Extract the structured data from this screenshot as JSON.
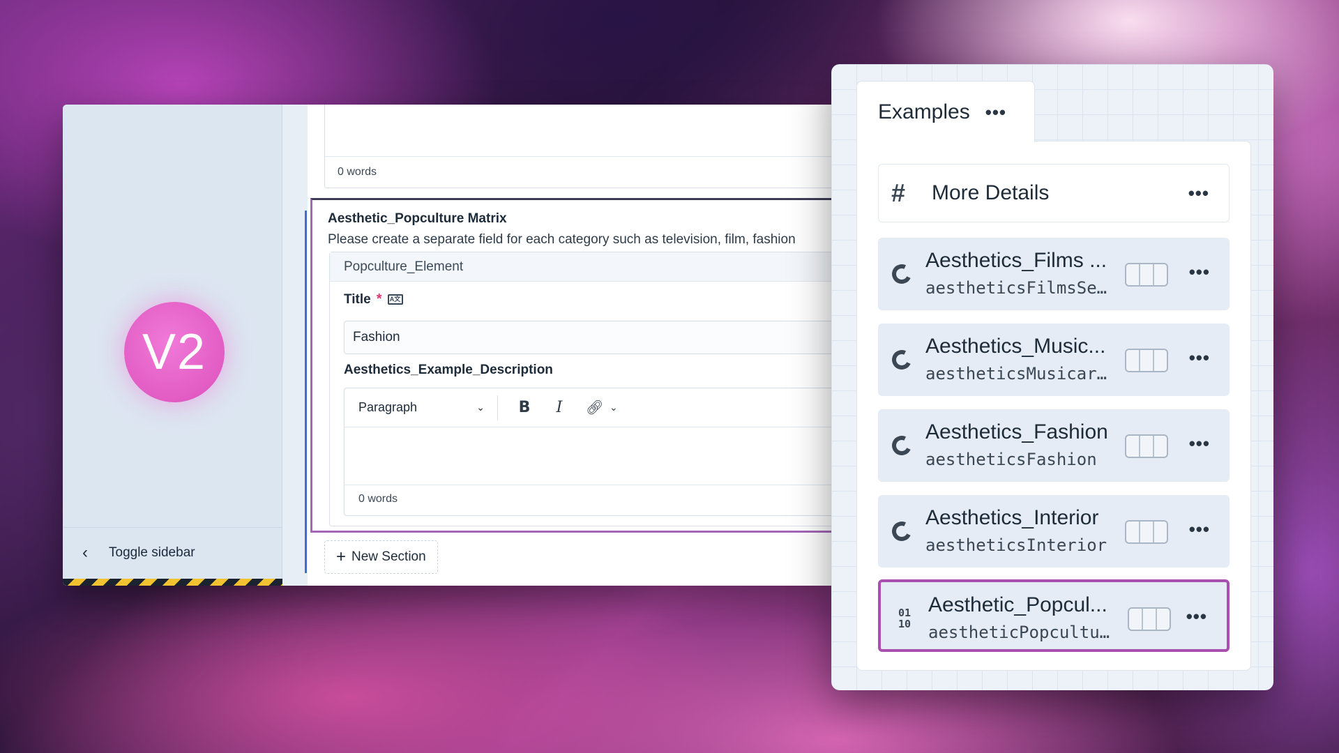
{
  "editor": {
    "sidebar": {
      "version_badge": "V2",
      "toggle_label": "Toggle sidebar"
    },
    "top_field": {
      "word_count": "0 words"
    },
    "matrix": {
      "title": "Aesthetic_Popculture Matrix",
      "description": "Please create a separate field for each category such as television, film, fashion",
      "element_type": "Popculture_Element",
      "title_label": "Title",
      "title_value": "Fashion",
      "description_label": "Aesthetics_Example_Description",
      "block_format": "Paragraph",
      "bold_label": "B",
      "italic_label": "I",
      "word_count": "0 words"
    },
    "new_section_label": "New Section"
  },
  "panel": {
    "tab_label": "Examples",
    "details_label": "More Details",
    "entries": [
      {
        "title": "Aesthetics_Films ...",
        "handle": "aestheticsFilmsSe…",
        "icon": "cms-icon"
      },
      {
        "title": "Aesthetics_Music...",
        "handle": "aestheticsMusicar…",
        "icon": "cms-icon"
      },
      {
        "title": "Aesthetics_Fashion",
        "handle": "aestheticsFashion",
        "icon": "cms-icon"
      },
      {
        "title": "Aesthetics_Interior",
        "handle": "aestheticsInterior",
        "icon": "cms-icon"
      },
      {
        "title": "Aesthetic_Popcul...",
        "handle": "aestheticPopcultu…",
        "icon": "binary-icon",
        "icon_text": "01\n10",
        "selected": true
      }
    ]
  },
  "colors": {
    "badge": "#e25cc4",
    "selection_border": "#a94fae",
    "gutter_line": "#3d6fd1",
    "required": "#e0356c"
  }
}
